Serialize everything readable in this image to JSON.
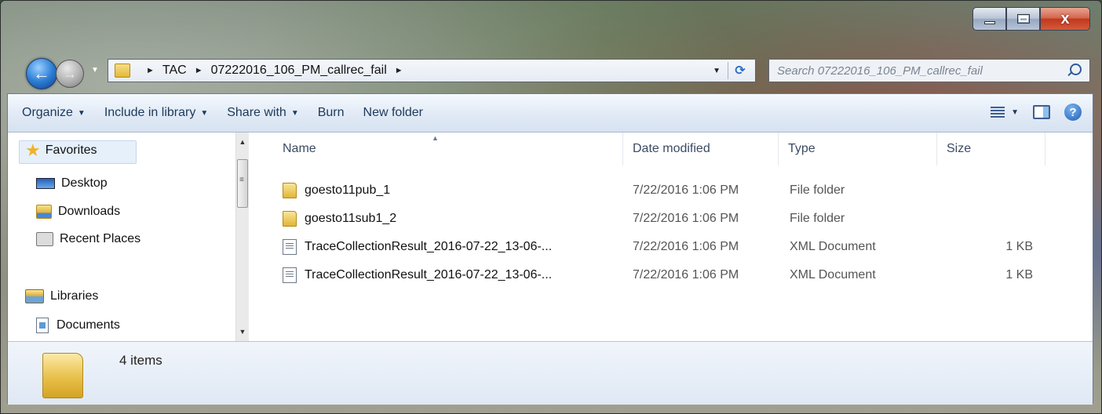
{
  "window": {
    "caption_buttons": {
      "minimize_icon": "minimize-icon",
      "maximize_icon": "maximize-icon",
      "close_icon": "close-icon",
      "close_glyph": "x"
    }
  },
  "nav": {
    "back_icon": "back-arrow-icon",
    "forward_icon": "forward-arrow-icon",
    "back_glyph": "←",
    "forward_glyph": "→",
    "breadcrumb": [
      "TAC",
      "07222016_106_PM_callrec_fail"
    ],
    "search_placeholder": "Search 07222016_106_PM_callrec_fail"
  },
  "toolbar": {
    "organize": "Organize",
    "include_in_library": "Include in library",
    "share_with": "Share with",
    "burn": "Burn",
    "new_folder": "New folder"
  },
  "sidebar": {
    "favorites": "Favorites",
    "items": [
      "Desktop",
      "Downloads",
      "Recent Places"
    ],
    "libraries": "Libraries",
    "library_items": [
      "Documents"
    ]
  },
  "columns": {
    "name": "Name",
    "date": "Date modified",
    "type": "Type",
    "size": "Size"
  },
  "files": [
    {
      "name": "goesto11pub_1",
      "date": "7/22/2016 1:06 PM",
      "type": "File folder",
      "size": "",
      "icon": "folder-icon"
    },
    {
      "name": "goesto11sub1_2",
      "date": "7/22/2016 1:06 PM",
      "type": "File folder",
      "size": "",
      "icon": "folder-icon"
    },
    {
      "name": "TraceCollectionResult_2016-07-22_13-06-...",
      "date": "7/22/2016 1:06 PM",
      "type": "XML Document",
      "size": "1 KB",
      "icon": "xml-file-icon"
    },
    {
      "name": "TraceCollectionResult_2016-07-22_13-06-...",
      "date": "7/22/2016 1:06 PM",
      "type": "XML Document",
      "size": "1 KB",
      "icon": "xml-file-icon"
    }
  ],
  "status": {
    "items_count": "4 items"
  }
}
